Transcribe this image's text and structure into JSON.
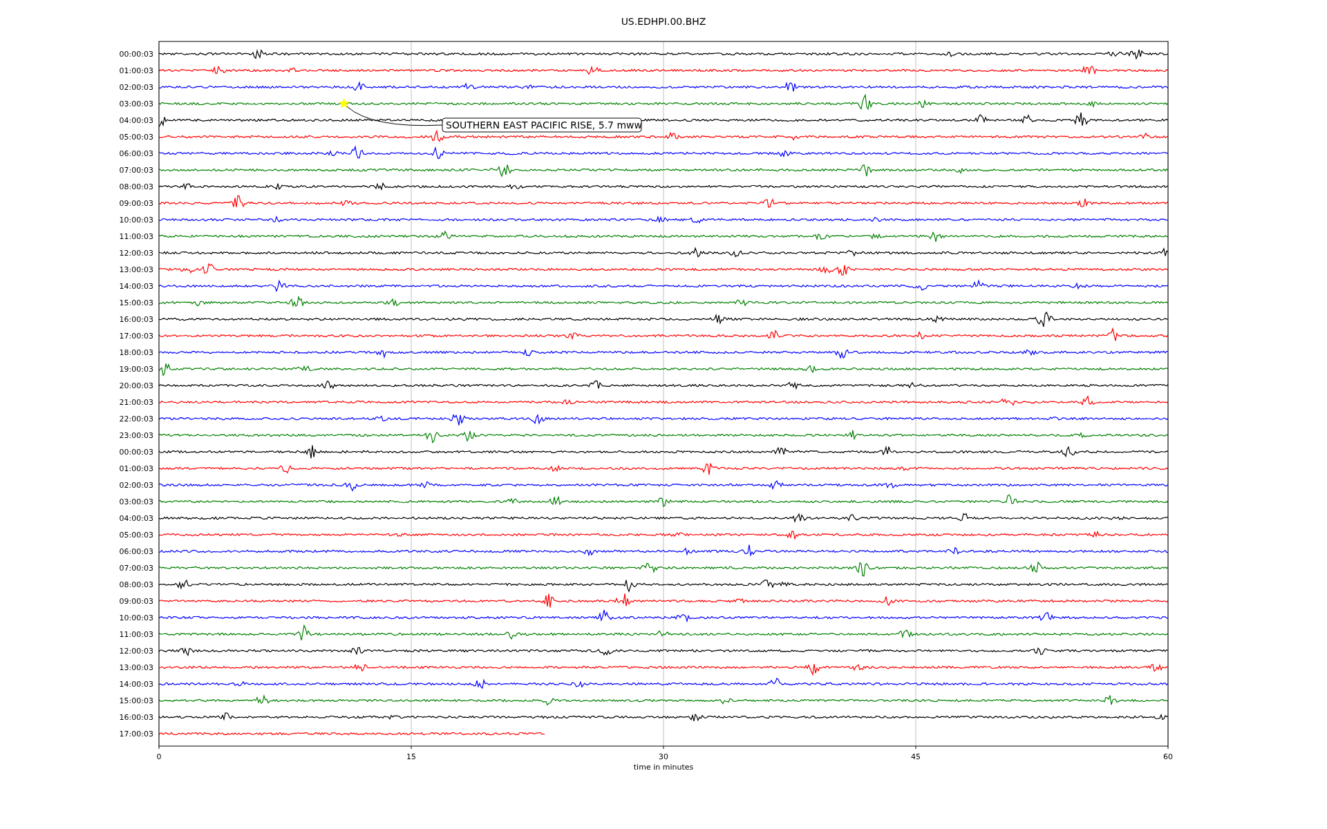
{
  "title": "US.EDHPI.00.BHZ",
  "rows": [
    {
      "label": "00:00:03",
      "color": "#000000",
      "kind": "full"
    },
    {
      "label": "01:00:03",
      "color": "#ff0000",
      "kind": "full"
    },
    {
      "label": "02:00:03",
      "color": "#0000ff",
      "kind": "full"
    },
    {
      "label": "03:00:03",
      "color": "#008000",
      "kind": "full",
      "event": {
        "label": "SOUTHERN EAST PACIFIC RISE, 5.7 mww"
      }
    },
    {
      "label": "04:00:03",
      "color": "#000000",
      "kind": "full"
    },
    {
      "label": "05:00:03",
      "color": "#ff0000",
      "kind": "full"
    },
    {
      "label": "06:00:03",
      "color": "#0000ff",
      "kind": "full"
    },
    {
      "label": "07:00:03",
      "color": "#008000",
      "kind": "full"
    },
    {
      "label": "08:00:03",
      "color": "#000000",
      "kind": "full"
    },
    {
      "label": "09:00:03",
      "color": "#ff0000",
      "kind": "full"
    },
    {
      "label": "10:00:03",
      "color": "#0000ff",
      "kind": "full"
    },
    {
      "label": "11:00:03",
      "color": "#008000",
      "kind": "full"
    },
    {
      "label": "12:00:03",
      "color": "#000000",
      "kind": "full"
    },
    {
      "label": "13:00:03",
      "color": "#ff0000",
      "kind": "full"
    },
    {
      "label": "14:00:03",
      "color": "#0000ff",
      "kind": "full"
    },
    {
      "label": "15:00:03",
      "color": "#008000",
      "kind": "full"
    },
    {
      "label": "16:00:03",
      "color": "#000000",
      "kind": "full"
    },
    {
      "label": "17:00:03",
      "color": "#ff0000",
      "kind": "full"
    },
    {
      "label": "18:00:03",
      "color": "#0000ff",
      "kind": "full"
    },
    {
      "label": "19:00:03",
      "color": "#008000",
      "kind": "full"
    },
    {
      "label": "20:00:03",
      "color": "#000000",
      "kind": "full"
    },
    {
      "label": "21:00:03",
      "color": "#ff0000",
      "kind": "full"
    },
    {
      "label": "22:00:03",
      "color": "#0000ff",
      "kind": "full"
    },
    {
      "label": "23:00:03",
      "color": "#008000",
      "kind": "full"
    },
    {
      "label": "00:00:03",
      "color": "#000000",
      "kind": "full"
    },
    {
      "label": "01:00:03",
      "color": "#ff0000",
      "kind": "full"
    },
    {
      "label": "02:00:03",
      "color": "#0000ff",
      "kind": "full"
    },
    {
      "label": "03:00:03",
      "color": "#008000",
      "kind": "full"
    },
    {
      "label": "04:00:03",
      "color": "#000000",
      "kind": "full"
    },
    {
      "label": "05:00:03",
      "color": "#ff0000",
      "kind": "full"
    },
    {
      "label": "06:00:03",
      "color": "#0000ff",
      "kind": "full"
    },
    {
      "label": "07:00:03",
      "color": "#008000",
      "kind": "full"
    },
    {
      "label": "08:00:03",
      "color": "#000000",
      "kind": "full"
    },
    {
      "label": "09:00:03",
      "color": "#ff0000",
      "kind": "full"
    },
    {
      "label": "10:00:03",
      "color": "#0000ff",
      "kind": "full"
    },
    {
      "label": "11:00:03",
      "color": "#008000",
      "kind": "full"
    },
    {
      "label": "12:00:03",
      "color": "#000000",
      "kind": "full"
    },
    {
      "label": "13:00:03",
      "color": "#ff0000",
      "kind": "full"
    },
    {
      "label": "14:00:03",
      "color": "#0000ff",
      "kind": "full"
    },
    {
      "label": "15:00:03",
      "color": "#008000",
      "kind": "full"
    },
    {
      "label": "16:00:03",
      "color": "#000000",
      "kind": "full"
    },
    {
      "label": "17:00:03",
      "color": "#ff0000",
      "kind": "partial"
    }
  ],
  "x_axis": {
    "label": "time in minutes",
    "ticks": [
      "0",
      "15",
      "30",
      "45",
      "60"
    ]
  }
}
